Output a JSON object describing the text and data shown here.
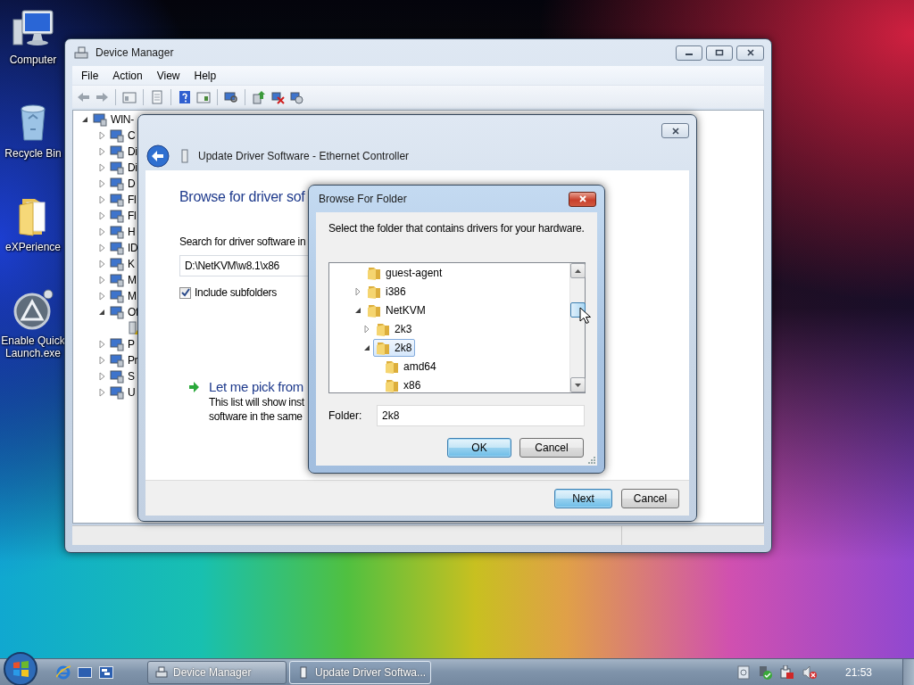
{
  "desktop_icons": [
    {
      "label": "Computer",
      "kind": "computer"
    },
    {
      "label": "Recycle Bin",
      "kind": "recycle-bin"
    },
    {
      "label": "eXPerience",
      "kind": "folder"
    },
    {
      "label": "Enable Quick Launch.exe",
      "kind": "app"
    }
  ],
  "device_manager": {
    "title": "Device Manager",
    "menu": [
      "File",
      "Action",
      "View",
      "Help"
    ],
    "tree": {
      "label": "WIN-",
      "expanded": true,
      "children": [
        {
          "label": "C",
          "expanded": false
        },
        {
          "label": "Di",
          "expanded": false
        },
        {
          "label": "Di",
          "expanded": false
        },
        {
          "label": "D",
          "expanded": false
        },
        {
          "label": "Fl",
          "expanded": false
        },
        {
          "label": "Fl",
          "expanded": false
        },
        {
          "label": "H",
          "expanded": false
        },
        {
          "label": "ID",
          "expanded": false
        },
        {
          "label": "K",
          "expanded": false
        },
        {
          "label": "M",
          "expanded": false
        },
        {
          "label": "M",
          "expanded": false
        },
        {
          "label": "Of",
          "expanded": true,
          "children": [
            {
              "kind": "warning-device"
            }
          ]
        },
        {
          "label": "P",
          "expanded": false
        },
        {
          "label": "Pr",
          "expanded": false
        },
        {
          "label": "S",
          "expanded": false
        },
        {
          "label": "U",
          "expanded": false
        }
      ]
    }
  },
  "update_driver": {
    "title": "Update Driver Software - Ethernet Controller",
    "heading": "Browse for driver sof",
    "search_label": "Search for driver software in",
    "path": "D:\\NetKVM\\w8.1\\x86",
    "include_subfolders": {
      "label": "Include subfolders",
      "checked": true
    },
    "pick": {
      "label": "Let me pick from",
      "description": [
        "This list will show inst",
        "software in the same"
      ]
    },
    "buttons": [
      {
        "label": "Next",
        "default": true
      },
      {
        "label": "Cancel",
        "default": false
      }
    ]
  },
  "browse_folder": {
    "title": "Browse For Folder",
    "instruction": "Select the folder that contains drivers for your hardware.",
    "tree": [
      {
        "label": "guest-agent",
        "selected": false
      },
      {
        "label": "i386",
        "expanded": false,
        "selected": false
      },
      {
        "label": "NetKVM",
        "expanded": true,
        "selected": false,
        "children": [
          {
            "label": "2k3",
            "expanded": false,
            "selected": false
          },
          {
            "label": "2k8",
            "expanded": true,
            "selected": true,
            "children": [
              {
                "label": "amd64",
                "selected": false
              },
              {
                "label": "x86",
                "selected": false
              }
            ]
          }
        ]
      }
    ],
    "folder": {
      "label": "Folder:",
      "value": "2k8"
    },
    "buttons": [
      {
        "label": "OK",
        "default": true
      },
      {
        "label": "Cancel",
        "default": false
      }
    ]
  },
  "taskbar": {
    "tasks": [
      {
        "label": "Device Manager",
        "selected": false
      },
      {
        "label": "Update Driver Softwa...",
        "selected": true
      }
    ],
    "clock": "21:53"
  }
}
